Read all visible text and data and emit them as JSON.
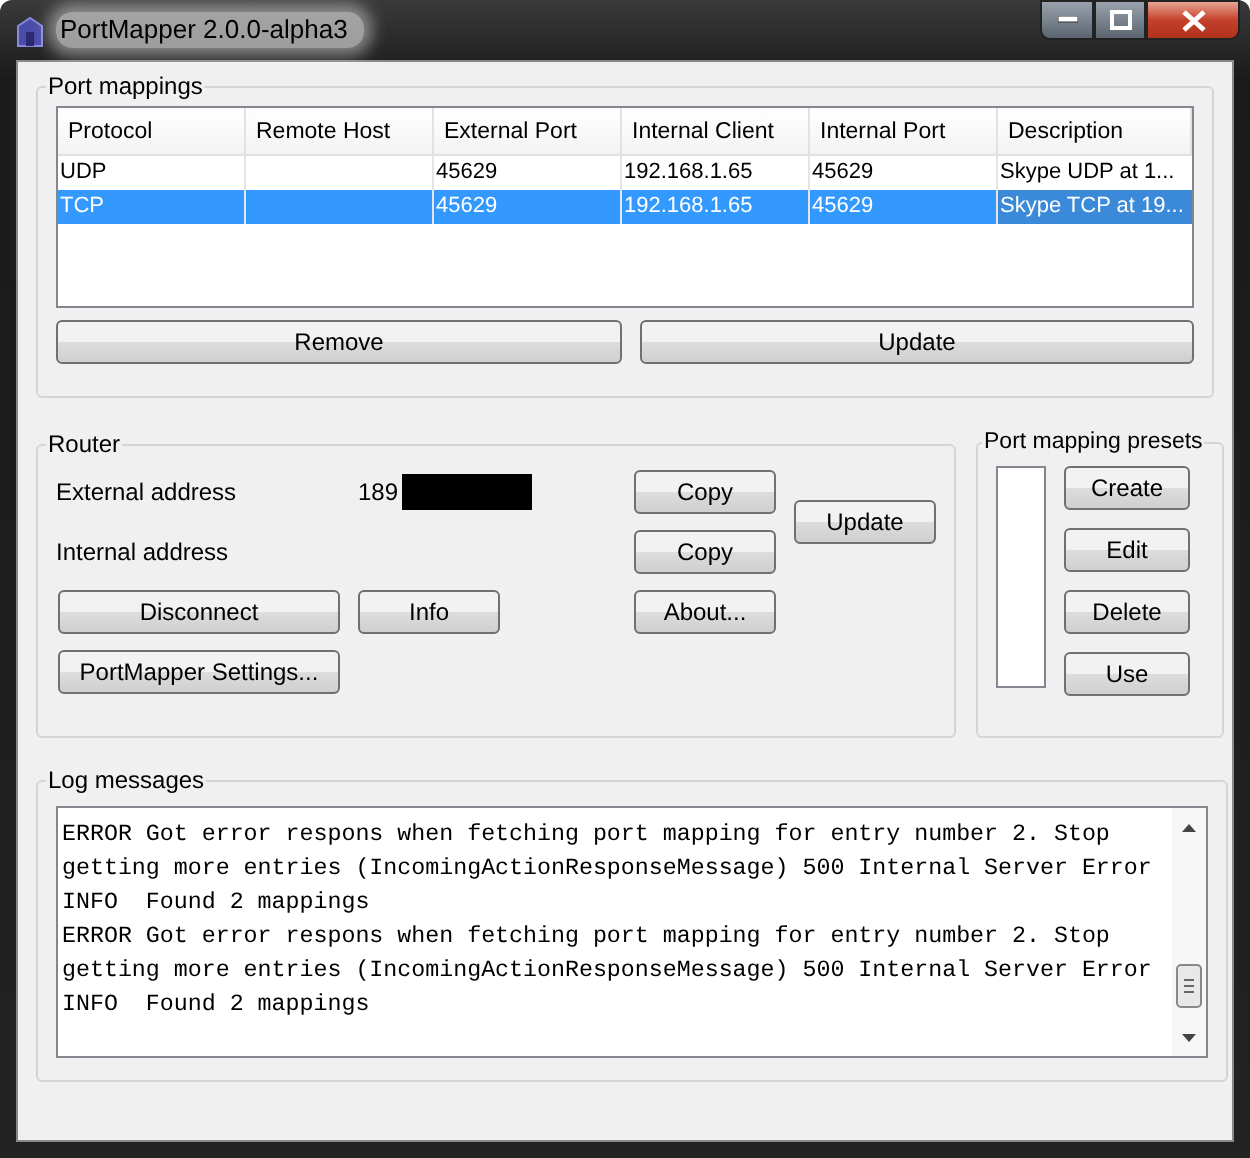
{
  "window": {
    "title": "PortMapper 2.0.0-alpha3"
  },
  "port_mappings": {
    "title": "Port mappings",
    "columns": [
      "Protocol",
      "Remote Host",
      "External Port",
      "Internal Client",
      "Internal Port",
      "Description"
    ],
    "rows": [
      {
        "cells": [
          "UDP",
          "",
          "45629",
          "192.168.1.65",
          "45629",
          "Skype UDP at 1..."
        ],
        "selected": false
      },
      {
        "cells": [
          "TCP",
          "",
          "45629",
          "192.168.1.65",
          "45629",
          "Skype TCP at 19..."
        ],
        "selected": true
      }
    ],
    "remove_button": "Remove",
    "update_button": "Update"
  },
  "router": {
    "title": "Router",
    "external_address_label": "External address",
    "external_address_value": "189",
    "internal_address_label": "Internal address",
    "copy_external_button": "Copy",
    "copy_internal_button": "Copy",
    "update_button": "Update",
    "disconnect_button": "Disconnect",
    "info_button": "Info",
    "about_button": "About...",
    "settings_button": "PortMapper Settings..."
  },
  "presets": {
    "title": "Port mapping presets",
    "buttons": [
      "Create",
      "Edit",
      "Delete",
      "Use"
    ]
  },
  "log": {
    "title": "Log messages",
    "entries": [
      "ERROR Got error respons when fetching port mapping for entry number 2. Stop getting more entries (IncomingActionResponseMessage) 500 Internal Server Error",
      "INFO  Found 2 mappings",
      "ERROR Got error respons when fetching port mapping for entry number 2. Stop getting more entries (IncomingActionResponseMessage) 500 Internal Server Error",
      "INFO  Found 2 mappings"
    ]
  }
}
